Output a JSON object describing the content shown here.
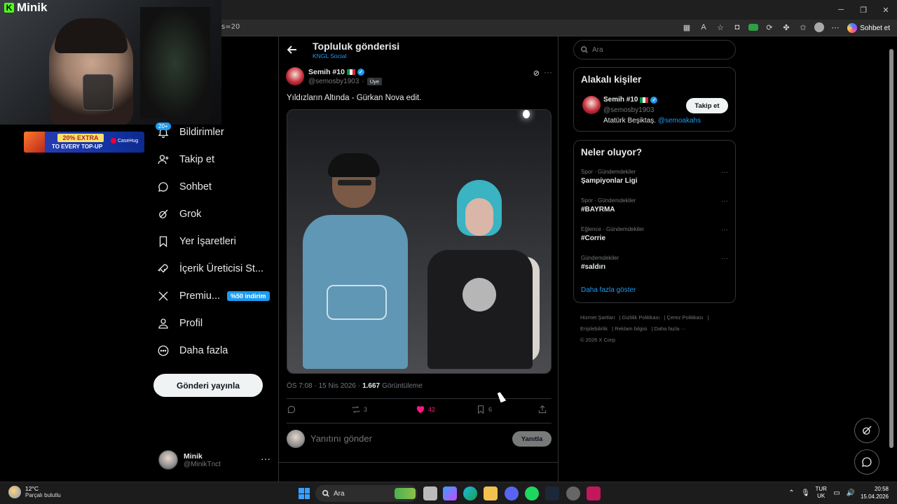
{
  "stream": {
    "brand": "Minik"
  },
  "browser": {
    "url_fragment": "s=20",
    "chat_button": "Sohbet et"
  },
  "ad": {
    "line1": "20% EXTRA",
    "line2": "TO EVERY TOP-UP",
    "brand": "CaseHug"
  },
  "nav": {
    "notifications_badge": "20+",
    "items": [
      {
        "label": "Bildirimler",
        "icon": "bell-icon"
      },
      {
        "label": "Takip et",
        "icon": "person-plus-icon"
      },
      {
        "label": "Sohbet",
        "icon": "chat-bubble-icon"
      },
      {
        "label": "Grok",
        "icon": "grok-icon"
      },
      {
        "label": "Yer İşaretleri",
        "icon": "bookmark-icon"
      },
      {
        "label": "İçerik Üreticisi St...",
        "icon": "rocket-icon"
      },
      {
        "label": "Premiu...",
        "icon": "x-logo-icon"
      },
      {
        "label": "Profil",
        "icon": "person-icon"
      },
      {
        "label": "Daha fazla",
        "icon": "more-circle-icon"
      }
    ],
    "premium_badge": "%50 indirim",
    "post_button": "Gönderi yayınla"
  },
  "account": {
    "name": "Minik",
    "handle": "@MinikTnct"
  },
  "header": {
    "title": "Topluluk gönderisi",
    "subtitle": "KNGL Social"
  },
  "post": {
    "author_name": "Semih #10",
    "author_handle": "@semosby1903",
    "member_badge": "Üye",
    "text": "Yıldızların Altında - Gürkan Nova edit.",
    "time": "ÖS 7:08 · 15 Nis 2026 ·",
    "views_count": "1.667",
    "views_label": "Görüntüleme",
    "retweets": "3",
    "likes": "42",
    "bookmarks": "6",
    "reply_placeholder": "Yanıtını gönder",
    "reply_button": "Yanıtla"
  },
  "right": {
    "search_placeholder": "Ara",
    "related_title": "Alakalı kişiler",
    "related": {
      "name": "Semih #10",
      "handle": "@semosby1903",
      "bio": "Atatürk Beşiktaş.",
      "mention": "@semoakahs",
      "follow_button": "Takip et"
    },
    "trending_title": "Neler oluyor?",
    "trends": [
      {
        "category": "Spor · Gündemdekiler",
        "name": "Şampiyonlar Ligi"
      },
      {
        "category": "Spor · Gündemdekiler",
        "name": "#BAYRMA"
      },
      {
        "category": "Eğlence · Gündemdekiler",
        "name": "#Corrie"
      },
      {
        "category": "Gündemdekiler",
        "name": "#saldırı"
      }
    ],
    "show_more": "Daha fazla göster",
    "footer": [
      "Hizmet Şartları",
      "Gizlilik Politikası",
      "Çerez Politikası",
      "Erişilebilirlik",
      "Reklam bilgisi",
      "Daha fazla ···",
      "© 2026 X Corp."
    ]
  },
  "taskbar": {
    "temperature": "12°C",
    "weather": "Parçalı bulutlu",
    "search_placeholder": "Ara",
    "lang_top": "TUR",
    "lang_bottom": "UK",
    "time": "20:58",
    "date": "15.04.2026"
  },
  "colors": {
    "accent": "#1d9bf0",
    "like": "#f91880",
    "background": "#000000",
    "border": "#2f3336"
  }
}
